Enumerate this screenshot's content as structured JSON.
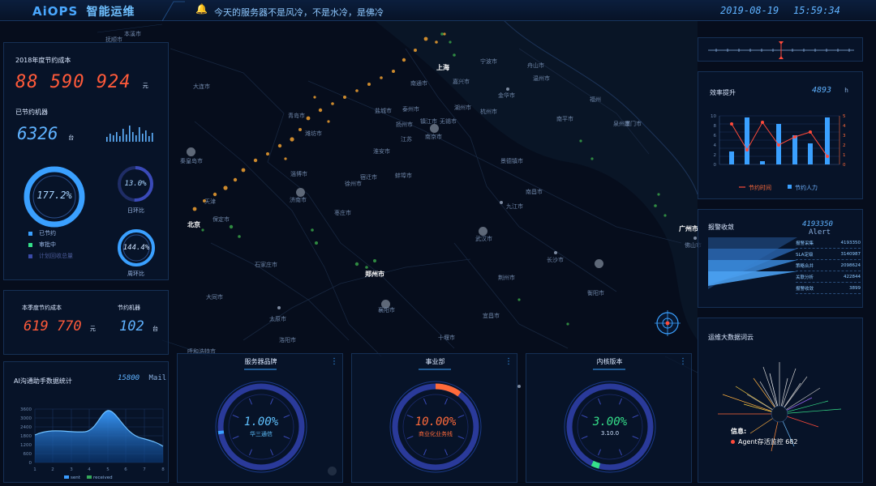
{
  "header": {
    "logo": "AiOPS",
    "title": "智能运维",
    "bell_icon": "bell-icon",
    "notice": "今天的服务器不是风冷，不是水冷，是佛冷",
    "date": "2019-08-19",
    "time": "15:59:34"
  },
  "savings": {
    "title": "2018年度节约成本",
    "amount": "88 590 924",
    "amount_unit": "元",
    "machines_label": "已节约机器",
    "machines": "6326",
    "machines_unit": "台",
    "ring_main": "177.2%",
    "ring_day": "13.0%",
    "ring_day_label": "日环比",
    "ring_week": "144.4%",
    "ring_week_label": "周环比",
    "legend": [
      "已节约",
      "审批中",
      "计划回收总量"
    ],
    "legend_colors": [
      "#3aa0ff",
      "#35e08a",
      "#3a4aa8"
    ]
  },
  "quarter": {
    "cost_label": "本季度节约成本",
    "cost": "619 770",
    "cost_unit": "元",
    "machine_label": "节约机器",
    "machine": "102",
    "machine_unit": "台"
  },
  "ai_mail": {
    "title": "AI沟通助手数据统计",
    "count": "15800",
    "count_unit": "Mail",
    "yticks": [
      "3600",
      "3000",
      "2400",
      "1800",
      "1200",
      "600",
      "0"
    ],
    "xticks": [
      "1",
      "2",
      "3",
      "4",
      "5",
      "6",
      "7",
      "8"
    ],
    "legend": [
      "sent",
      "received"
    ]
  },
  "efficiency": {
    "title": "效率提升",
    "value": "4893",
    "unit": "h",
    "legend": [
      "节约时间",
      "节约人力"
    ],
    "yticks_left": [
      "10",
      "8",
      "6",
      "4",
      "2",
      "0"
    ],
    "yticks_right": [
      "5",
      "4",
      "3",
      "2",
      "1",
      "0"
    ]
  },
  "alarm": {
    "title": "报警收敛",
    "value": "4193350",
    "unit": "Alert",
    "rows": [
      {
        "label": "报警采集",
        "value": "4193350"
      },
      {
        "label": "SLA定级",
        "value": "3140987"
      },
      {
        "label": "策略合并",
        "value": "2098624"
      },
      {
        "label": "关联分析",
        "value": "422844"
      },
      {
        "label": "报警收敛",
        "value": "3899"
      }
    ]
  },
  "wordcloud": {
    "title": "运维大数据词云",
    "info_label": "信息:",
    "info_value": "Agent存活监控 682"
  },
  "bottom": [
    {
      "title": "服务器品牌",
      "pct": "1.00%",
      "sub": "华三通信",
      "accent": "#3aa0ff",
      "textcolor": "#5fc2ff",
      "progress": 0.01
    },
    {
      "title": "事业部",
      "pct": "10.00%",
      "sub": "商业化业务线",
      "accent": "#ff6a3a",
      "textcolor": "#ff6a3a",
      "progress": 0.1
    },
    {
      "title": "内核版本",
      "pct": "3.00%",
      "sub": "3.10.0",
      "accent": "#35e08a",
      "textcolor": "#35e08a",
      "progress": 0.03
    }
  ],
  "map": {
    "cities": [
      {
        "name": "本溪市"
      },
      {
        "name": "抚顺市"
      },
      {
        "name": "大连市"
      },
      {
        "name": "上海"
      },
      {
        "name": "宁波市"
      },
      {
        "name": "舟山市"
      },
      {
        "name": "南通市"
      },
      {
        "name": "嘉兴市"
      },
      {
        "name": "湖州市"
      },
      {
        "name": "杭州市"
      },
      {
        "name": "盐城市"
      },
      {
        "name": "泰州市"
      },
      {
        "name": "扬州市"
      },
      {
        "name": "镇江市"
      },
      {
        "name": "无锡市"
      },
      {
        "name": "江苏"
      },
      {
        "name": "南京市"
      },
      {
        "name": "青岛市"
      },
      {
        "name": "温州市"
      },
      {
        "name": "金华市"
      },
      {
        "name": "福州"
      },
      {
        "name": "泉州市"
      },
      {
        "name": "厦门市"
      },
      {
        "name": "秦皇岛市"
      },
      {
        "name": "淄博市"
      },
      {
        "name": "潍坊市"
      },
      {
        "name": "宿迁市"
      },
      {
        "name": "徐州市"
      },
      {
        "name": "蚌埠市"
      },
      {
        "name": "淮安市"
      },
      {
        "name": "景德镇市"
      },
      {
        "name": "济南市"
      },
      {
        "name": "枣庄市"
      },
      {
        "name": "天津"
      },
      {
        "name": "北京"
      },
      {
        "name": "保定市"
      },
      {
        "name": "石家庄市"
      },
      {
        "name": "南昌市"
      },
      {
        "name": "九江市"
      },
      {
        "name": "广州市"
      },
      {
        "name": "佛山市"
      },
      {
        "name": "武汉市"
      },
      {
        "name": "长沙市"
      },
      {
        "name": "郑州市"
      },
      {
        "name": "荆州市"
      },
      {
        "name": "宜昌市"
      },
      {
        "name": "襄阳市"
      },
      {
        "name": "太原市"
      },
      {
        "name": "洛阳市"
      },
      {
        "name": "十堰市"
      },
      {
        "name": "大同市"
      },
      {
        "name": "呼和浩特市"
      },
      {
        "name": "衡阳市"
      },
      {
        "name": "南平市"
      }
    ]
  }
}
